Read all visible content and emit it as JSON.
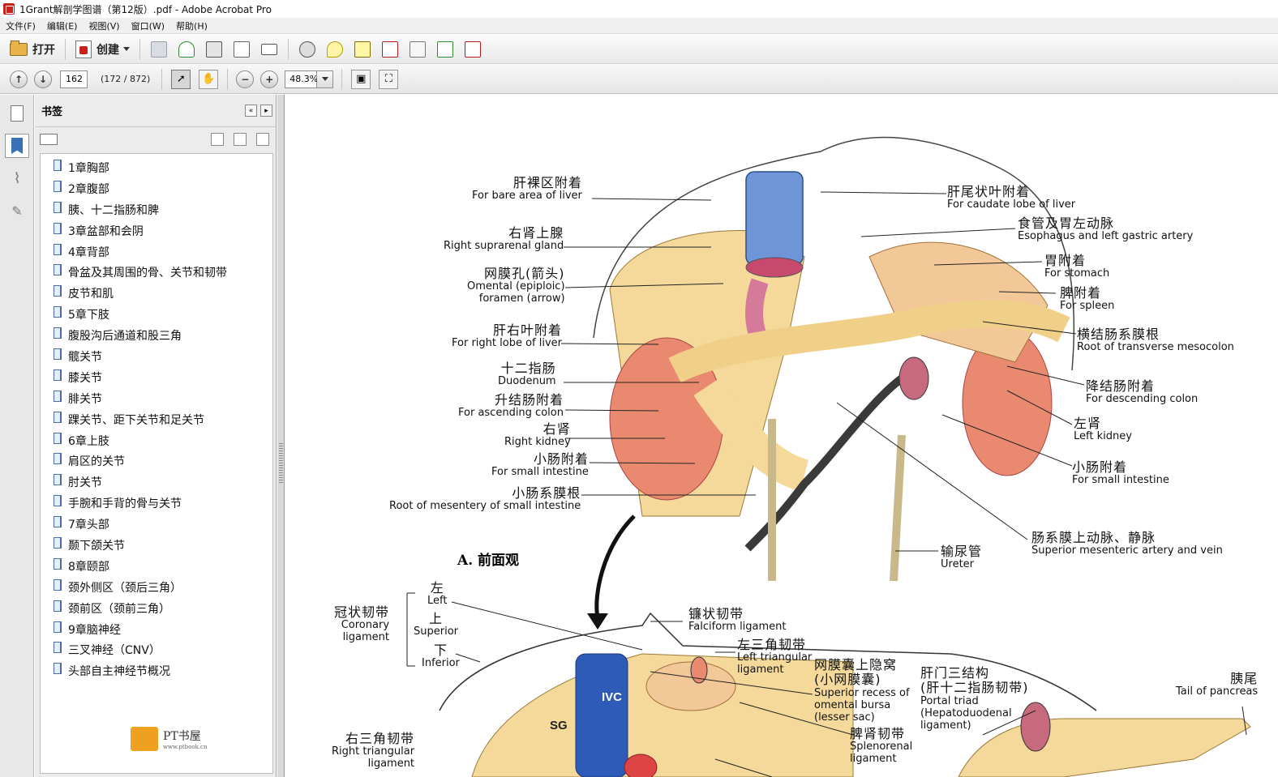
{
  "window": {
    "title": "1Grant解剖学图谱（第12版）.pdf - Adobe Acrobat Pro"
  },
  "menu": [
    "文件(F)",
    "编辑(E)",
    "视图(V)",
    "窗口(W)",
    "帮助(H)"
  ],
  "toolbar": {
    "open_label": "打开",
    "create_label": "创建"
  },
  "nav": {
    "page": "162",
    "page_count": "(172 / 872)",
    "zoom": "48.3%"
  },
  "bookmarks_panel": {
    "title": "书签",
    "items": [
      "1章胸部",
      "2章腹部",
      "胰、十二指肠和脾",
      "3章盆部和会阴",
      "4章背部",
      "骨盆及其周围的骨、关节和韧带",
      "皮节和肌",
      "5章下肢",
      "腹股沟后通道和股三角",
      "髋关节",
      "膝关节",
      "腓关节",
      "踝关节、距下关节和足关节",
      "6章上肢",
      "肩区的关节",
      "肘关节",
      "手腕和手背的骨与关节",
      "7章头部",
      "颞下颌关节",
      "8章颐部",
      "颈外侧区（颈后三角）",
      "颈前区（颈前三角）",
      "9章脑神经",
      "三叉神经（CNV）",
      "头部自主神经节概况"
    ],
    "watermark": "PT书屋",
    "watermark_sub": "www.ptbook.cn"
  },
  "figure": {
    "labels_left": [
      {
        "zh": "肝裸区附着",
        "en": "For bare area of liver"
      },
      {
        "zh": "右肾上腺",
        "en": "Right suprarenal gland"
      },
      {
        "zh": "网膜孔(箭头)",
        "en": "Omental (epiploic)",
        "en2": "foramen (arrow)"
      },
      {
        "zh": "肝右叶附着",
        "en": "For right lobe of liver"
      },
      {
        "zh": "十二指肠",
        "en": "Duodenum"
      },
      {
        "zh": "升结肠附着",
        "en": "For ascending colon"
      },
      {
        "zh": "右肾",
        "en": "Right kidney"
      },
      {
        "zh": "小肠附着",
        "en": "For small intestine"
      },
      {
        "zh": "小肠系膜根",
        "en": "Root of mesentery of small intestine"
      }
    ],
    "labels_right": [
      {
        "zh": "肝尾状叶附着",
        "en": "For caudate lobe of liver"
      },
      {
        "zh": "食管及胃左动脉",
        "en": "Esophagus and left gastric artery"
      },
      {
        "zh": "胃附着",
        "en": "For stomach"
      },
      {
        "zh": "脾附着",
        "en": "For spleen"
      },
      {
        "zh": "横结肠系膜根",
        "en": "Root of transverse mesocolon"
      },
      {
        "zh": "降结肠附着",
        "en": "For descending colon"
      },
      {
        "zh": "左肾",
        "en": "Left kidney"
      },
      {
        "zh": "小肠附着",
        "en": "For small intestine"
      },
      {
        "zh": "肠系膜上动脉、静脉",
        "en": "Superior mesenteric artery and vein"
      },
      {
        "zh": "输尿管",
        "en": "Ureter"
      }
    ],
    "view_title": "A. 前面观",
    "lower_labels": [
      {
        "zh": "冠状韧带",
        "en": "Coronary",
        "en2": "ligament"
      },
      {
        "zh": "左",
        "en": "Left"
      },
      {
        "zh": "上",
        "en": "Superior"
      },
      {
        "zh": "下",
        "en": "Inferior"
      },
      {
        "zh": "镰状韧带",
        "en": "Falciform ligament"
      },
      {
        "zh": "左三角韧带",
        "en": "Left triangular",
        "en2": "ligament"
      },
      {
        "zh": "网膜囊上隐窝",
        "zh2": "(小网膜囊)",
        "en": "Superior recess of",
        "en2": "omental bursa",
        "en3": "(lesser sac)"
      },
      {
        "zh": "肝门三结构",
        "zh2": "(肝十二指肠韧带)",
        "en": "Portal triad",
        "en2": "(Hepatoduodenal",
        "en3": "ligament)"
      },
      {
        "zh": "胰尾",
        "en": "Tail of pancreas"
      },
      {
        "zh": "脾肾韧带",
        "en": "Splenorenal",
        "en2": "ligament"
      },
      {
        "zh": "右三角韧带",
        "en": "Right triangular",
        "en2": "ligament"
      }
    ],
    "structure_marks": [
      "IVC",
      "SG"
    ]
  }
}
